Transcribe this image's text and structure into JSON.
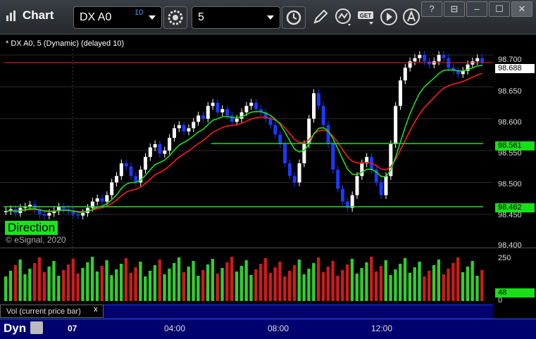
{
  "app": {
    "title": "Chart"
  },
  "toolbar": {
    "symbol": "DX A0",
    "symbol_sup": "10",
    "interval": "5",
    "icons": [
      "gear-icon",
      "clock-icon",
      "pencil-icon",
      "study-icon",
      "get-icon",
      "play-icon",
      "cursor-icon"
    ]
  },
  "window": {
    "buttons": [
      "?",
      "⊟",
      "–",
      "☐",
      "✕"
    ]
  },
  "chart": {
    "caption": "* DX A0, 5 (Dynamic) (delayed 10)",
    "copyright": "© eSignal, 2020",
    "badge": "Direction",
    "price_axis": [
      "98.700",
      "98.650",
      "98.600",
      "98.550",
      "98.500",
      "98.450",
      "98.400"
    ],
    "last_price": "98.688",
    "level_upper": "98.561",
    "level_lower": "98.462",
    "vol_axis": [
      "250",
      "0"
    ],
    "vol_last": "48",
    "vol_caption": "Vol (current price bar)",
    "vol_caption_close": "x",
    "time_axis": {
      "day": "07",
      "ticks": [
        "04:00",
        "08:00",
        "12:00"
      ]
    },
    "dyn_label": "Dyn",
    "colors": {
      "up": "#ffffff",
      "down": "#1a3aff",
      "ema_red": "#ff1a1a",
      "ema_green": "#18e018",
      "vol_up": "#2fd02f",
      "vol_down": "#d01a1a"
    }
  },
  "chart_data": {
    "type": "candlestick",
    "ylim": [
      98.4,
      98.72
    ],
    "levels": [
      98.561,
      98.462
    ],
    "last": 98.688,
    "closes": [
      98.455,
      98.458,
      98.452,
      98.46,
      98.462,
      98.465,
      98.458,
      98.45,
      98.448,
      98.452,
      98.455,
      98.462,
      98.458,
      98.455,
      98.45,
      98.448,
      98.452,
      98.46,
      98.47,
      98.475,
      98.47,
      98.48,
      98.5,
      98.51,
      98.53,
      98.525,
      98.51,
      98.5,
      98.52,
      98.54,
      98.555,
      98.56,
      98.545,
      98.55,
      98.57,
      98.585,
      98.59,
      98.58,
      98.585,
      98.595,
      98.605,
      98.6,
      98.62,
      98.625,
      98.61,
      98.615,
      98.605,
      98.595,
      98.6,
      98.61,
      98.62,
      98.625,
      98.615,
      98.61,
      98.6,
      98.59,
      98.575,
      98.56,
      98.53,
      98.51,
      98.5,
      98.53,
      98.56,
      98.6,
      98.64,
      98.62,
      98.59,
      98.56,
      98.52,
      98.49,
      98.47,
      98.46,
      98.48,
      98.51,
      98.53,
      98.54,
      98.52,
      98.5,
      98.48,
      98.51,
      98.56,
      98.62,
      98.66,
      98.68,
      98.69,
      98.695,
      98.7,
      98.69,
      98.685,
      98.69,
      98.7,
      98.695,
      98.68,
      98.675,
      98.67,
      98.675,
      98.685,
      98.69,
      98.695,
      98.688
    ]
  }
}
